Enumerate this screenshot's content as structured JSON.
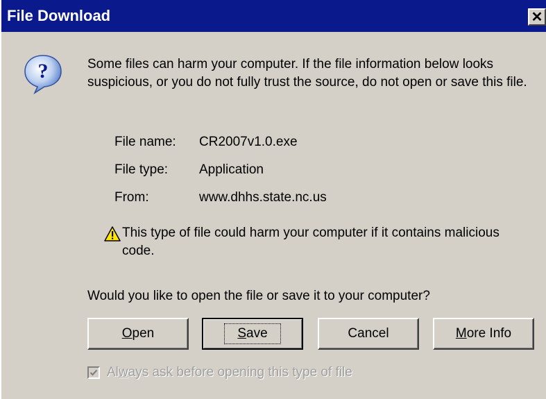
{
  "window": {
    "title": "File Download",
    "close_glyph": "✕"
  },
  "message": "Some files can harm your computer. If the file information below looks suspicious, or you do not fully trust the source, do not open or save this file.",
  "file_info": {
    "name_label": "File name:",
    "name_value": "CR2007v1.0.exe",
    "type_label": "File type:",
    "type_value": "Application",
    "from_label": "From:",
    "from_value": "www.dhhs.state.nc.us"
  },
  "warning": "This type of file could harm your computer if it contains malicious code.",
  "question": "Would you like to open the file or save it to your computer?",
  "buttons": {
    "open": {
      "accel": "O",
      "rest": "pen"
    },
    "save": {
      "accel": "S",
      "rest": "ave"
    },
    "cancel": "Cancel",
    "more_info": {
      "accel": "M",
      "rest": "ore Info"
    }
  },
  "checkbox": {
    "label_pre": "Al",
    "label_accel": "w",
    "label_post": "ays ask before opening this type of file",
    "checked": true,
    "disabled": true
  },
  "icons": {
    "question": "question-icon",
    "warning": "warning-icon"
  },
  "colors": {
    "titlebar": "#0a1a8c",
    "face": "#d4d0c8",
    "warning_yellow": "#ffe600"
  }
}
